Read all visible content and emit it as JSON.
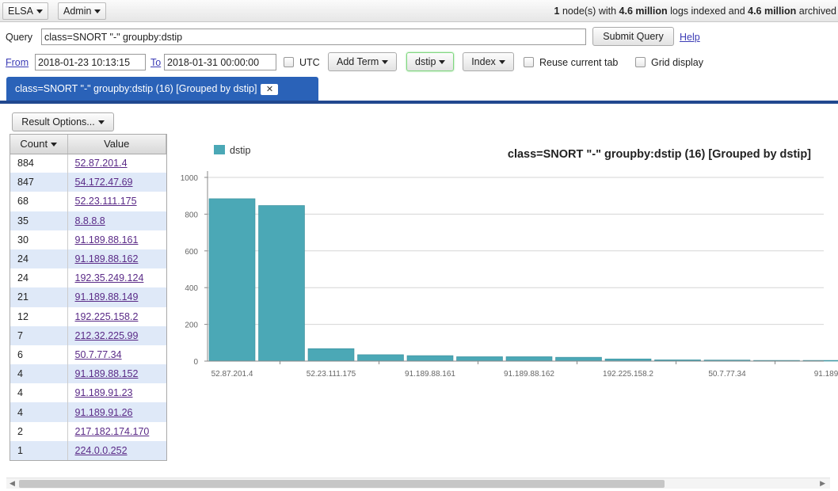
{
  "topbar": {
    "menus": [
      {
        "label": "ELSA"
      },
      {
        "label": "Admin"
      }
    ],
    "status": {
      "nodes": "1",
      "t1": " node(s) with ",
      "logs_indexed": "4.6 million",
      "t2": " logs indexed and ",
      "logs_archived": "4.6 million",
      "t3": " archived"
    }
  },
  "query": {
    "label": "Query",
    "value": "class=SNORT \"-\" groupby:dstip",
    "submit_label": "Submit Query",
    "help_label": "Help"
  },
  "filters": {
    "from_label": "From",
    "from_value": "2018-01-23 10:13:15",
    "to_label": "To",
    "to_value": "2018-01-31 00:00:00",
    "utc_label": "UTC",
    "add_term_label": "Add Term",
    "dstip_label": "dstip",
    "index_label": "Index",
    "reuse_tab_label": "Reuse current tab",
    "grid_display_label": "Grid display"
  },
  "tab": {
    "title": "class=SNORT \"-\" groupby:dstip (16) [Grouped by dstip]",
    "close": "✕"
  },
  "results": {
    "options_label": "Result Options...",
    "col_count": "Count",
    "col_value": "Value",
    "rows": [
      {
        "count": "884",
        "value": "52.87.201.4"
      },
      {
        "count": "847",
        "value": "54.172.47.69"
      },
      {
        "count": "68",
        "value": "52.23.111.175"
      },
      {
        "count": "35",
        "value": "8.8.8.8"
      },
      {
        "count": "30",
        "value": "91.189.88.161"
      },
      {
        "count": "24",
        "value": "91.189.88.162"
      },
      {
        "count": "24",
        "value": "192.35.249.124"
      },
      {
        "count": "21",
        "value": "91.189.88.149"
      },
      {
        "count": "12",
        "value": "192.225.158.2"
      },
      {
        "count": "7",
        "value": "212.32.225.99"
      },
      {
        "count": "6",
        "value": "50.7.77.34"
      },
      {
        "count": "4",
        "value": "91.189.88.152"
      },
      {
        "count": "4",
        "value": "91.189.91.23"
      },
      {
        "count": "4",
        "value": "91.189.91.26"
      },
      {
        "count": "2",
        "value": "217.182.174.170"
      },
      {
        "count": "1",
        "value": "224.0.0.252"
      }
    ]
  },
  "chart_data": {
    "type": "bar",
    "title": "class=SNORT \"-\" groupby:dstip (16) [Grouped by dstip]",
    "legend_position": "top-left",
    "bar_color": "#4ba8b6",
    "series": [
      {
        "name": "dstip",
        "values": [
          884,
          847,
          68,
          35,
          30,
          24,
          24,
          21,
          12,
          7,
          6,
          4,
          4
        ]
      }
    ],
    "categories": [
      "52.87.201.4",
      "54.172.47.69",
      "52.23.111.175",
      "8.8.8.8",
      "91.189.88.161",
      "91.189.88.162",
      "192.35.249.124",
      "91.189.88.149",
      "192.225.158.2",
      "212.32.225.99",
      "50.7.77.34",
      "91.189.88.152",
      "91.189.91.23"
    ],
    "tick_labels": [
      "52.87.201.4",
      "52.23.111.175",
      "91.189.88.161",
      "91.189.88.162",
      "192.225.158.2",
      "50.7.77.34",
      "91.189"
    ],
    "yticks": [
      0,
      200,
      400,
      600,
      800,
      1000
    ],
    "ylim": [
      0,
      1000
    ],
    "grid": true
  }
}
